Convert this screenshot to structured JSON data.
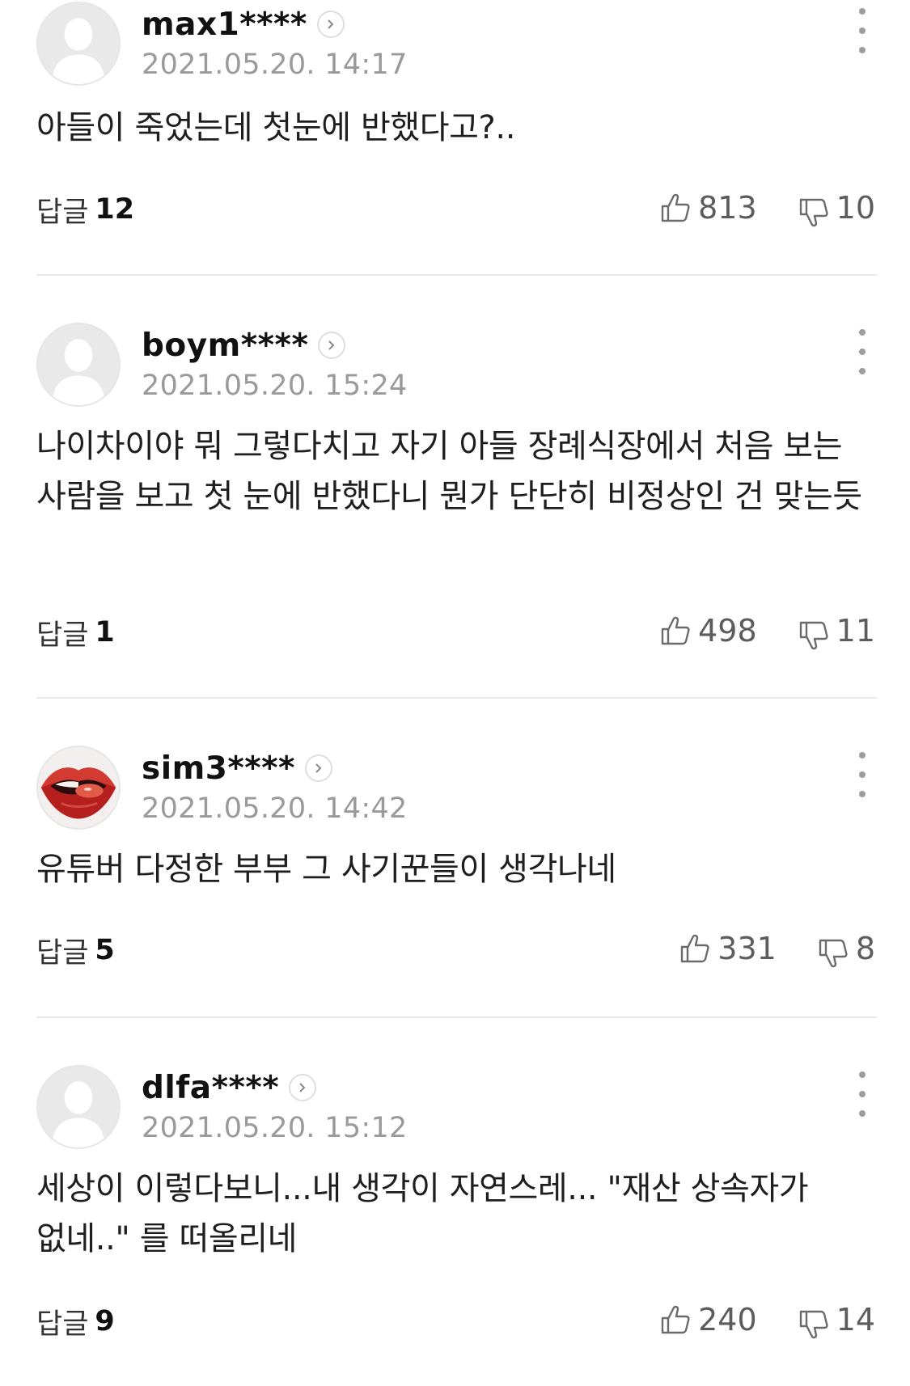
{
  "comments": [
    {
      "username": "max1****",
      "timestamp": "2021.05.20. 14:17",
      "body": "아들이 죽었는데 첫눈에 반했다고?..",
      "reply_label": "답글",
      "reply_count": "12",
      "likes": "813",
      "dislikes": "10",
      "avatar": "default-profile-icon"
    },
    {
      "username": "boym****",
      "timestamp": "2021.05.20. 15:24",
      "body": "나이차이야 뭐 그렇다치고 자기 아들 장례식장에서 처음 보는 사람을 보고 첫 눈에 반했다니 뭔가 단단히 비정상인 건 맞는듯",
      "reply_label": "답글",
      "reply_count": "1",
      "likes": "498",
      "dislikes": "11",
      "avatar": "default-profile-icon"
    },
    {
      "username": "sim3****",
      "timestamp": "2021.05.20. 14:42",
      "body": "유튜버 다정한 부부 그 사기꾼들이 생각나네",
      "reply_label": "답글",
      "reply_count": "5",
      "likes": "331",
      "dislikes": "8",
      "avatar": "lips-photo"
    },
    {
      "username": "dlfa****",
      "timestamp": "2021.05.20. 15:12",
      "body": "세상이 이렇다보니...내 생각이 자연스레... \"재산 상속자가 없네..\" 를 떠올리네",
      "reply_label": "답글",
      "reply_count": "9",
      "likes": "240",
      "dislikes": "14",
      "avatar": "default-profile-icon"
    }
  ],
  "icons": {
    "like": "thumbs-up-icon",
    "dislike": "thumbs-down-icon",
    "more": "more-vertical-icon",
    "profile": "chevron-right-icon"
  },
  "colors": {
    "username": "#111111",
    "timestamp": "#9a9a9a",
    "divider": "#ebebeb",
    "vote_text": "#5c5c5c"
  }
}
